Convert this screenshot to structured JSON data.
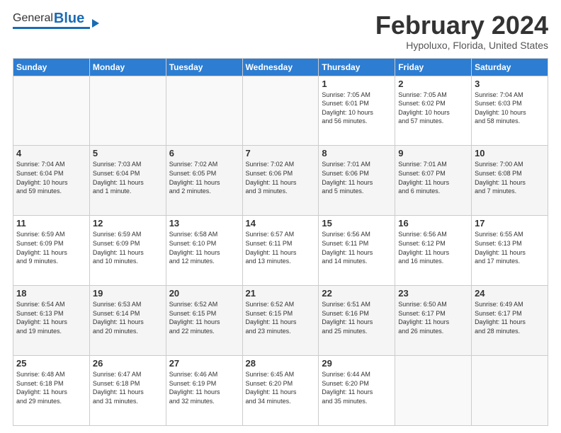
{
  "header": {
    "logo_general": "General",
    "logo_blue": "Blue",
    "month": "February 2024",
    "location": "Hypoluxo, Florida, United States"
  },
  "weekdays": [
    "Sunday",
    "Monday",
    "Tuesday",
    "Wednesday",
    "Thursday",
    "Friday",
    "Saturday"
  ],
  "weeks": [
    [
      {
        "day": "",
        "info": ""
      },
      {
        "day": "",
        "info": ""
      },
      {
        "day": "",
        "info": ""
      },
      {
        "day": "",
        "info": ""
      },
      {
        "day": "1",
        "info": "Sunrise: 7:05 AM\nSunset: 6:01 PM\nDaylight: 10 hours\nand 56 minutes."
      },
      {
        "day": "2",
        "info": "Sunrise: 7:05 AM\nSunset: 6:02 PM\nDaylight: 10 hours\nand 57 minutes."
      },
      {
        "day": "3",
        "info": "Sunrise: 7:04 AM\nSunset: 6:03 PM\nDaylight: 10 hours\nand 58 minutes."
      }
    ],
    [
      {
        "day": "4",
        "info": "Sunrise: 7:04 AM\nSunset: 6:04 PM\nDaylight: 10 hours\nand 59 minutes."
      },
      {
        "day": "5",
        "info": "Sunrise: 7:03 AM\nSunset: 6:04 PM\nDaylight: 11 hours\nand 1 minute."
      },
      {
        "day": "6",
        "info": "Sunrise: 7:02 AM\nSunset: 6:05 PM\nDaylight: 11 hours\nand 2 minutes."
      },
      {
        "day": "7",
        "info": "Sunrise: 7:02 AM\nSunset: 6:06 PM\nDaylight: 11 hours\nand 3 minutes."
      },
      {
        "day": "8",
        "info": "Sunrise: 7:01 AM\nSunset: 6:06 PM\nDaylight: 11 hours\nand 5 minutes."
      },
      {
        "day": "9",
        "info": "Sunrise: 7:01 AM\nSunset: 6:07 PM\nDaylight: 11 hours\nand 6 minutes."
      },
      {
        "day": "10",
        "info": "Sunrise: 7:00 AM\nSunset: 6:08 PM\nDaylight: 11 hours\nand 7 minutes."
      }
    ],
    [
      {
        "day": "11",
        "info": "Sunrise: 6:59 AM\nSunset: 6:09 PM\nDaylight: 11 hours\nand 9 minutes."
      },
      {
        "day": "12",
        "info": "Sunrise: 6:59 AM\nSunset: 6:09 PM\nDaylight: 11 hours\nand 10 minutes."
      },
      {
        "day": "13",
        "info": "Sunrise: 6:58 AM\nSunset: 6:10 PM\nDaylight: 11 hours\nand 12 minutes."
      },
      {
        "day": "14",
        "info": "Sunrise: 6:57 AM\nSunset: 6:11 PM\nDaylight: 11 hours\nand 13 minutes."
      },
      {
        "day": "15",
        "info": "Sunrise: 6:56 AM\nSunset: 6:11 PM\nDaylight: 11 hours\nand 14 minutes."
      },
      {
        "day": "16",
        "info": "Sunrise: 6:56 AM\nSunset: 6:12 PM\nDaylight: 11 hours\nand 16 minutes."
      },
      {
        "day": "17",
        "info": "Sunrise: 6:55 AM\nSunset: 6:13 PM\nDaylight: 11 hours\nand 17 minutes."
      }
    ],
    [
      {
        "day": "18",
        "info": "Sunrise: 6:54 AM\nSunset: 6:13 PM\nDaylight: 11 hours\nand 19 minutes."
      },
      {
        "day": "19",
        "info": "Sunrise: 6:53 AM\nSunset: 6:14 PM\nDaylight: 11 hours\nand 20 minutes."
      },
      {
        "day": "20",
        "info": "Sunrise: 6:52 AM\nSunset: 6:15 PM\nDaylight: 11 hours\nand 22 minutes."
      },
      {
        "day": "21",
        "info": "Sunrise: 6:52 AM\nSunset: 6:15 PM\nDaylight: 11 hours\nand 23 minutes."
      },
      {
        "day": "22",
        "info": "Sunrise: 6:51 AM\nSunset: 6:16 PM\nDaylight: 11 hours\nand 25 minutes."
      },
      {
        "day": "23",
        "info": "Sunrise: 6:50 AM\nSunset: 6:17 PM\nDaylight: 11 hours\nand 26 minutes."
      },
      {
        "day": "24",
        "info": "Sunrise: 6:49 AM\nSunset: 6:17 PM\nDaylight: 11 hours\nand 28 minutes."
      }
    ],
    [
      {
        "day": "25",
        "info": "Sunrise: 6:48 AM\nSunset: 6:18 PM\nDaylight: 11 hours\nand 29 minutes."
      },
      {
        "day": "26",
        "info": "Sunrise: 6:47 AM\nSunset: 6:18 PM\nDaylight: 11 hours\nand 31 minutes."
      },
      {
        "day": "27",
        "info": "Sunrise: 6:46 AM\nSunset: 6:19 PM\nDaylight: 11 hours\nand 32 minutes."
      },
      {
        "day": "28",
        "info": "Sunrise: 6:45 AM\nSunset: 6:20 PM\nDaylight: 11 hours\nand 34 minutes."
      },
      {
        "day": "29",
        "info": "Sunrise: 6:44 AM\nSunset: 6:20 PM\nDaylight: 11 hours\nand 35 minutes."
      },
      {
        "day": "",
        "info": ""
      },
      {
        "day": "",
        "info": ""
      }
    ]
  ]
}
